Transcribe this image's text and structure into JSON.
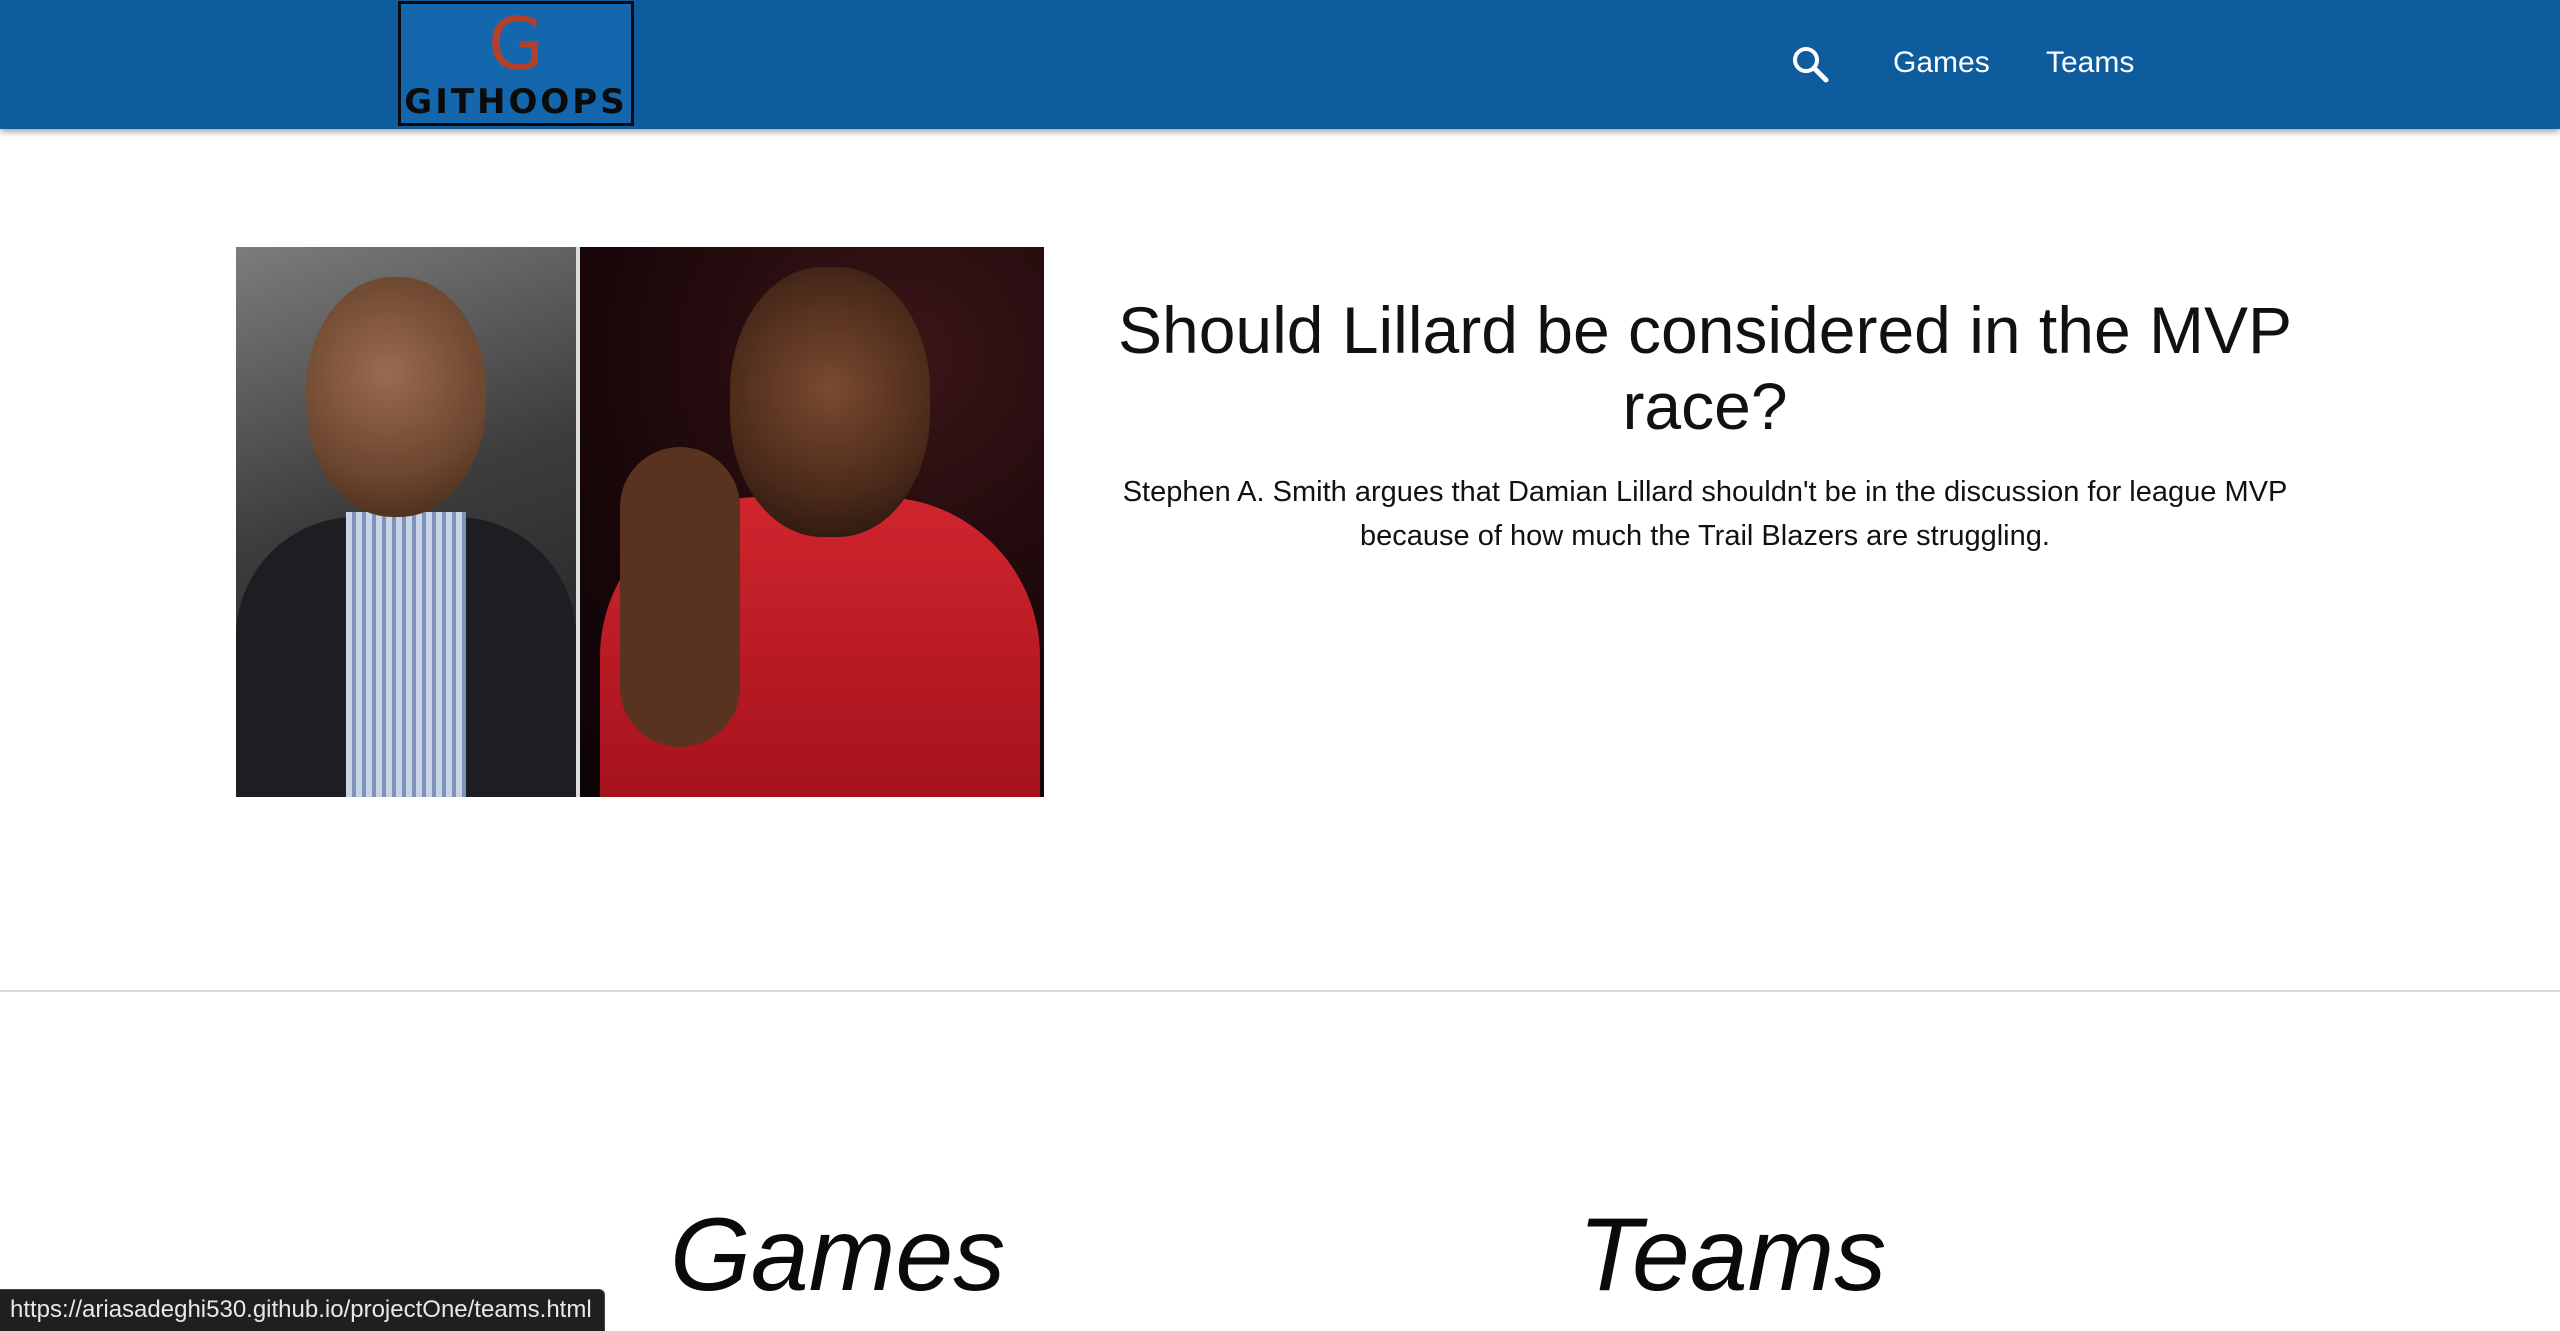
{
  "nav": {
    "logo_letter": "G",
    "logo_text": "GITHOOPS",
    "links": [
      {
        "label": "Games"
      },
      {
        "label": "Teams"
      }
    ],
    "colors": {
      "bar": "#0e5c9e",
      "logo_letter": "#b3402a"
    },
    "search_icon": "search-icon"
  },
  "article": {
    "headline": "Should Lillard be considered in the MVP race?",
    "summary": "Stephen A. Smith argues that Damian Lillard shouldn't be in the discussion for league MVP because of how much the Trail Blazers are struggling."
  },
  "sections": [
    {
      "heading": "Games"
    },
    {
      "heading": "Teams"
    }
  ],
  "status_bar": {
    "url": "https://ariasadeghi530.github.io/projectOne/teams.html"
  }
}
